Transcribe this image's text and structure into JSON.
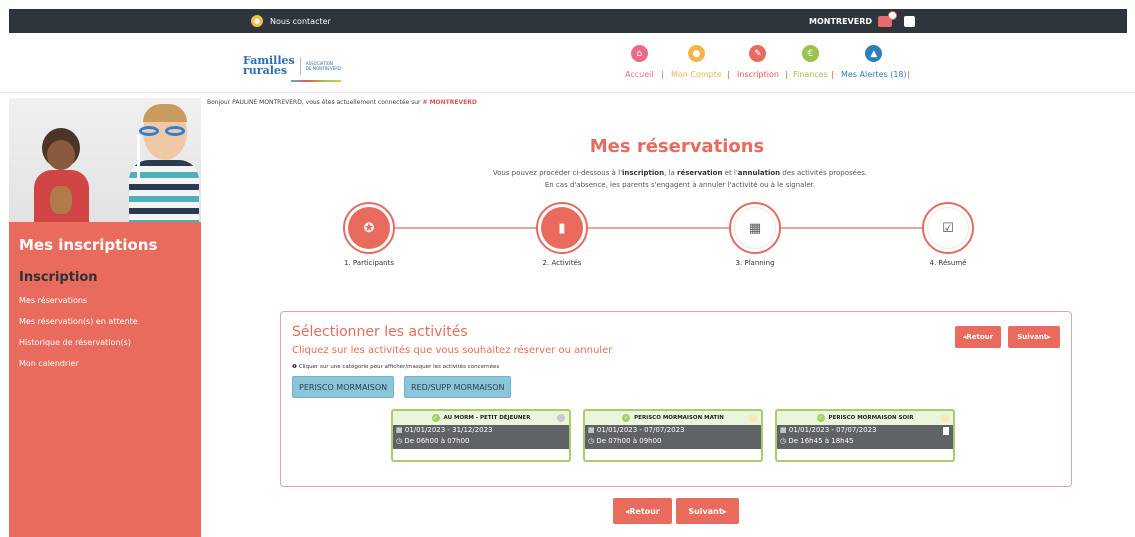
{
  "topbar": {
    "contact_label": "Nous contacter",
    "username": "MONTREVERD"
  },
  "logo": {
    "brand_line1": "Familles",
    "brand_line2": "rurales",
    "assoc_line1": "ASSOCIATION",
    "assoc_line2": "DE MONTREVERD"
  },
  "menu": [
    {
      "label": "Accueil",
      "icon": "home-icon",
      "color": "#e86b8a"
    },
    {
      "label": "Mon Compte",
      "icon": "bell-icon",
      "color": "#f2b64a"
    },
    {
      "label": "Inscription",
      "icon": "pencil-icon",
      "color": "#e86b5e"
    },
    {
      "label": "Finances",
      "icon": "euro-icon",
      "color": "#9bc24a"
    },
    {
      "label": "Mes Alertes (18)",
      "icon": "warning-icon",
      "color": "#2d7fb8"
    }
  ],
  "sidebar": {
    "title": "Mes inscriptions",
    "subtitle": "Inscription",
    "links": [
      "Mes réservations",
      "Mes réservation(s) en attente",
      "Historique de réservation(s)",
      "Mon calendrier"
    ]
  },
  "greeting": {
    "text": "Bonjour PAULINE MONTREVERD, vous êtes actuellement connectée sur",
    "site": "# MONTREVERD"
  },
  "page": {
    "title": "Mes réservations",
    "intro_a": "Vous pouvez procéder ci-dessous à l'",
    "intro_b": "inscription",
    "intro_c": ", la ",
    "intro_d": "réservation",
    "intro_e": " et l'",
    "intro_f": "annulation",
    "intro_g": " des activités proposées.",
    "intro_line2": "En cas d'absence, les parents s'engagent à annuler l'activité ou à le signaler."
  },
  "steps": [
    {
      "label": "1. Participants",
      "icon": "users-icon",
      "state": "active"
    },
    {
      "label": "2. Activités",
      "icon": "book-icon",
      "state": "active"
    },
    {
      "label": "3. Planning",
      "icon": "calendar-icon",
      "state": "idle"
    },
    {
      "label": "4. Résumé",
      "icon": "checkbox-icon",
      "state": "idle"
    }
  ],
  "panel": {
    "title": "Sélectionner les activités",
    "subtitle": "Cliquez sur les activités que vous souhaitez réserver ou annuler",
    "note": "Cliquer sur une catégorie pour afficher/masquer les activités concernées",
    "categories": [
      "PERISCO MORMAISON",
      "RED/SUPP MORMAISON"
    ],
    "back_label": "◂Retour",
    "next_label": "Suivant▸"
  },
  "activities": [
    {
      "name": "AU MORM - PETIT DEJEUNER",
      "dates": "01/01/2023 - 31/12/2023",
      "hours": "De 06h00 à 07h00",
      "status_color": "#c9c9c9"
    },
    {
      "name": "PERISCO MORMAISON MATIN",
      "dates": "01/01/2023 - 07/07/2023",
      "hours": "De 07h00 à 09h00",
      "status_color": "#f2ecb0"
    },
    {
      "name": "PERISCO MORMAISON SOIR",
      "dates": "01/01/2023 - 07/07/2023",
      "hours": "De 16h45 à 18h45",
      "status_color": "#f2ecb0"
    }
  ],
  "footer_buttons": {
    "back_label": "◂Retour",
    "next_label": "Suivant▸"
  }
}
